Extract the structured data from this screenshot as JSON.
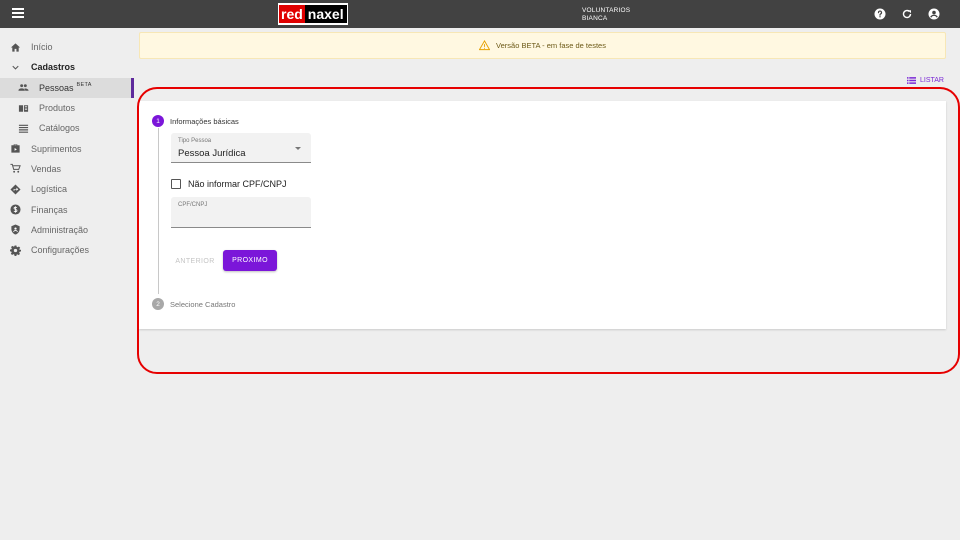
{
  "header": {
    "logo_red": "red",
    "logo_naxel": "naxel",
    "org_line1": "VOLUNTARIOS",
    "org_line2": "BIANCA",
    "icons": [
      "menu-icon",
      "help-icon",
      "refresh-icon",
      "account-icon"
    ]
  },
  "sidebar": {
    "items": [
      {
        "label": "Início",
        "icon": "home-icon"
      },
      {
        "label": "Cadastros",
        "icon": "chevron-down-icon"
      },
      {
        "label": "Pessoas",
        "badge": "BETA",
        "icon": "people-icon"
      },
      {
        "label": "Produtos",
        "icon": "book-icon"
      },
      {
        "label": "Catálogos",
        "icon": "list-icon"
      },
      {
        "label": "Suprimentos",
        "icon": "briefcase-icon"
      },
      {
        "label": "Vendas",
        "icon": "cart-icon"
      },
      {
        "label": "Logística",
        "icon": "directions-icon"
      },
      {
        "label": "Finanças",
        "icon": "dollar-icon"
      },
      {
        "label": "Administração",
        "icon": "shield-icon"
      },
      {
        "label": "Configurações",
        "icon": "gear-icon"
      }
    ]
  },
  "banner": {
    "text": "Versão BETA - em fase de testes",
    "icon": "warning-icon"
  },
  "listar": {
    "label": "LISTAR",
    "icon": "list-icon"
  },
  "stepper": {
    "step1": {
      "number": "1",
      "label": "Informações básicas"
    },
    "step2": {
      "number": "2",
      "label": "Selecione Cadastro"
    }
  },
  "form": {
    "tipo_pessoa": {
      "label": "Tipo Pessoa",
      "value": "Pessoa Jurídica"
    },
    "nao_informar": {
      "label": "Não informar CPF/CNPJ"
    },
    "cpf_cnpj": {
      "label": "CPF/CNPJ",
      "value": ""
    },
    "buttons": {
      "anterior": "ANTERIOR",
      "proximo": "PROXIMO"
    }
  },
  "colors": {
    "accent": "#7b16d9",
    "topbar": "#424242",
    "highlight": "#e60000"
  }
}
